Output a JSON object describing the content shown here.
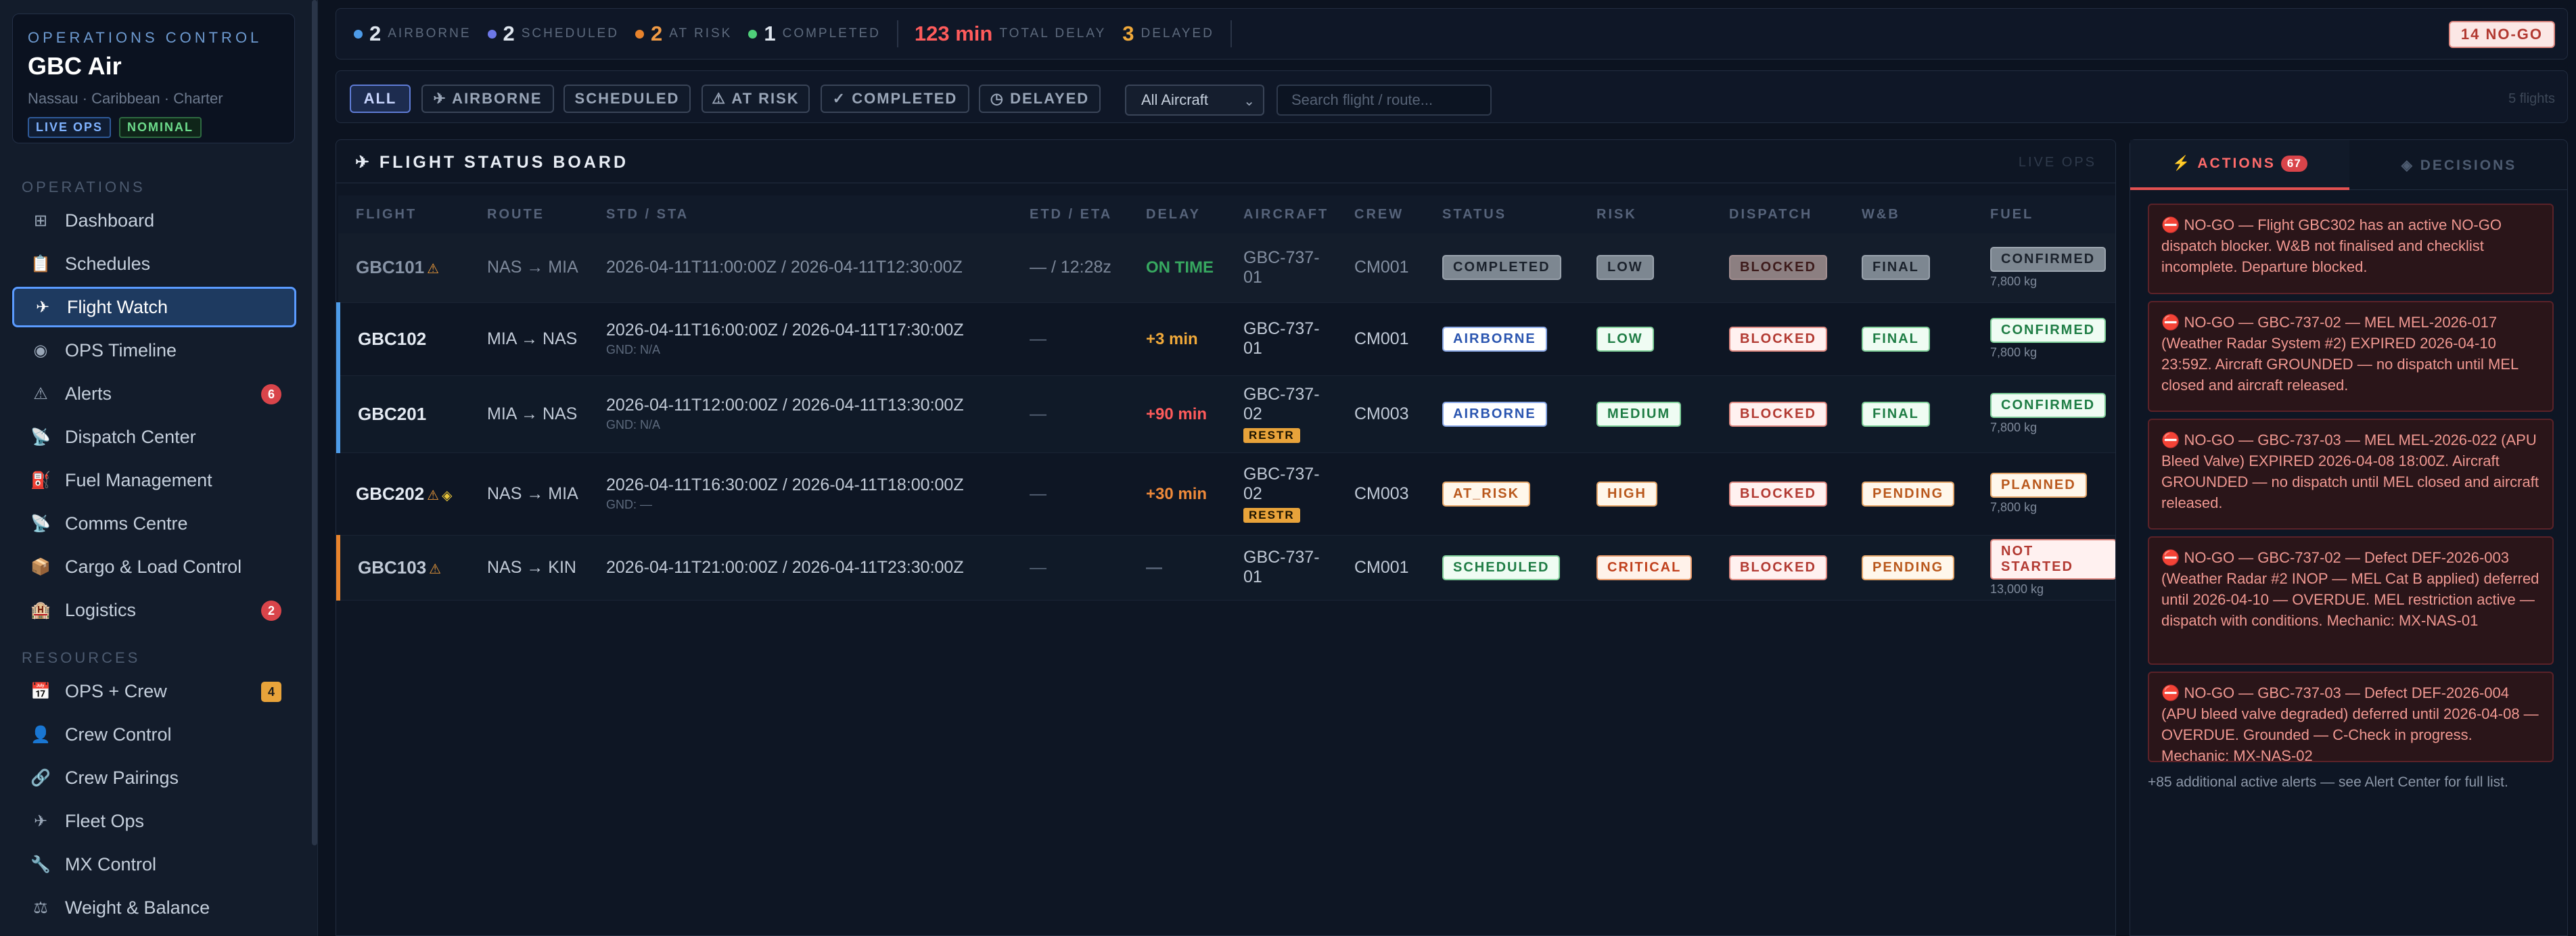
{
  "brand": {
    "kicker": "OPERATIONS CONTROL",
    "name": "GBC Air",
    "subtitle": "Nassau · Caribbean · Charter",
    "badge_live": "LIVE OPS",
    "badge_status": "NOMINAL"
  },
  "sidebar": {
    "operations_label": "OPERATIONS",
    "resources_label": "RESOURCES",
    "items": [
      {
        "label": "Dashboard",
        "icon": "grid-icon"
      },
      {
        "label": "Schedules",
        "icon": "clipboard-icon"
      },
      {
        "label": "Flight Watch",
        "icon": "plane-icon"
      },
      {
        "label": "OPS Timeline",
        "icon": "target-icon"
      },
      {
        "label": "Alerts",
        "icon": "warning-icon",
        "count": "6"
      },
      {
        "label": "Dispatch Center",
        "icon": "satellite-icon"
      },
      {
        "label": "Fuel Management",
        "icon": "fuel-icon"
      },
      {
        "label": "Comms Centre",
        "icon": "antenna-icon"
      },
      {
        "label": "Cargo & Load Control",
        "icon": "box-icon"
      },
      {
        "label": "Logistics",
        "icon": "hotel-icon",
        "count": "2"
      },
      {
        "label": "OPS + Crew",
        "icon": "calendar-icon",
        "count": "4"
      },
      {
        "label": "Crew Control",
        "icon": "person-icon"
      },
      {
        "label": "Crew Pairings",
        "icon": "link-icon"
      },
      {
        "label": "Fleet Ops",
        "icon": "plane-icon"
      },
      {
        "label": "MX Control",
        "icon": "wrench-icon"
      },
      {
        "label": "Weight & Balance",
        "icon": "scale-icon"
      }
    ]
  },
  "topbar": {
    "airborne_n": "2",
    "airborne_t": "AIRBORNE",
    "scheduled_n": "2",
    "scheduled_t": "SCHEDULED",
    "atrisk_n": "2",
    "atrisk_t": "AT RISK",
    "completed_n": "1",
    "completed_t": "COMPLETED",
    "delay_n": "123 min",
    "delay_t": "TOTAL DELAY",
    "delayed_n": "3",
    "delayed_t": "DELAYED",
    "nogo": "14 NO-GO",
    "colors": {
      "airborne": "#4d9be8",
      "scheduled": "#6d78e8",
      "atrisk": "#e8832c",
      "completed": "#4fd07a",
      "delay": "#ff5b5b",
      "delayed": "#f0a93a"
    }
  },
  "filters": {
    "all": "ALL",
    "airborne": "✈ AIRBORNE",
    "scheduled": "SCHEDULED",
    "atrisk": "⚠ AT RISK",
    "completed": "✓ COMPLETED",
    "delayed": "◷ DELAYED",
    "aircraft": "All Aircraft",
    "search_placeholder": "Search flight / route...",
    "count": "5 flights"
  },
  "board": {
    "title": "✈ FLIGHT STATUS BOARD",
    "live": "LIVE OPS",
    "cols": [
      "FLIGHT",
      "ROUTE",
      "STD / STA",
      "ETD / ETA",
      "DELAY",
      "AIRCRAFT",
      "CREW",
      "STATUS",
      "RISK",
      "DISPATCH",
      "W&B",
      "FUEL"
    ],
    "rows": [
      {
        "flight": "GBC101",
        "route": "NAS → MIA",
        "std": "2026-04-11T11:00:00Z / 2026-04-11T12:30:00Z",
        "gnd": "",
        "etd": "— / 12:28z",
        "delay": "ON TIME",
        "ac1": "GBC-737-",
        "ac2": "01",
        "restr": "",
        "crew": "CM001",
        "status": "COMPLETED",
        "risk": "LOW",
        "dispatch": "BLOCKED",
        "wb": "FINAL",
        "fuel": "CONFIRMED",
        "kg": "7,800 kg"
      },
      {
        "flight": "GBC102",
        "route": "MIA → NAS",
        "std": "2026-04-11T16:00:00Z / 2026-04-11T17:30:00Z",
        "gnd": "GND: N/A",
        "etd": "—",
        "delay": "+3 min",
        "ac1": "GBC-737-",
        "ac2": "01",
        "restr": "",
        "crew": "CM001",
        "status": "AIRBORNE",
        "risk": "LOW",
        "dispatch": "BLOCKED",
        "wb": "FINAL",
        "fuel": "CONFIRMED",
        "kg": "7,800 kg"
      },
      {
        "flight": "GBC201",
        "route": "MIA → NAS",
        "std": "2026-04-11T12:00:00Z / 2026-04-11T13:30:00Z",
        "gnd": "GND: N/A",
        "etd": "—",
        "delay": "+90 min",
        "ac1": "GBC-737-",
        "ac2": "02",
        "restr": "RESTR",
        "crew": "CM003",
        "status": "AIRBORNE",
        "risk": "MEDIUM",
        "dispatch": "BLOCKED",
        "wb": "FINAL",
        "fuel": "CONFIRMED",
        "kg": "7,800 kg"
      },
      {
        "flight": "GBC202",
        "route": "NAS → MIA",
        "std": "2026-04-11T16:30:00Z / 2026-04-11T18:00:00Z",
        "gnd": "GND: —",
        "etd": "—",
        "delay": "+30 min",
        "ac1": "GBC-737-",
        "ac2": "02",
        "restr": "RESTR",
        "crew": "CM003",
        "status": "AT_RISK",
        "risk": "HIGH",
        "dispatch": "BLOCKED",
        "wb": "PENDING",
        "fuel": "PLANNED",
        "kg": "7,800 kg"
      },
      {
        "flight": "GBC103",
        "route": "NAS → KIN",
        "std": "2026-04-11T21:00:00Z / 2026-04-11T23:30:00Z",
        "gnd": "",
        "etd": "—",
        "delay": "—",
        "ac1": "GBC-737-",
        "ac2": "01",
        "restr": "",
        "crew": "CM001",
        "status": "SCHEDULED",
        "risk": "CRITICAL",
        "dispatch": "BLOCKED",
        "wb": "PENDING",
        "fuel": "NOT STARTED",
        "kg": "13,000 kg"
      }
    ]
  },
  "panel": {
    "tab_actions": "⚡ ACTIONS",
    "actions_count": "67",
    "tab_decisions": "◈ DECISIONS",
    "alerts": [
      "⛔ NO-GO — Flight GBC302 has an active NO-GO dispatch blocker. W&B not finalised and checklist incomplete. Departure blocked.",
      "⛔ NO-GO — GBC-737-02 — MEL MEL-2026-017 (Weather Radar System #2) EXPIRED 2026-04-10 23:59Z. Aircraft GROUNDED — no dispatch until MEL closed and aircraft released.",
      "⛔ NO-GO — GBC-737-03 — MEL MEL-2026-022 (APU Bleed Valve) EXPIRED 2026-04-08 18:00Z. Aircraft GROUNDED — no dispatch until MEL closed and aircraft released.",
      "⛔ NO-GO — GBC-737-02 — Defect DEF-2026-003 (Weather Radar #2 INOP — MEL Cat B applied) deferred until 2026-04-10 — OVERDUE. MEL restriction active — dispatch with conditions. Mechanic: MX-NAS-01",
      "⛔ NO-GO — GBC-737-03 — Defect DEF-2026-004 (APU bleed valve degraded) deferred until 2026-04-08 — OVERDUE. Grounded — C-Check in progress. Mechanic: MX-NAS-02"
    ],
    "more": "+85 additional active alerts — see Alert Center for full list."
  }
}
